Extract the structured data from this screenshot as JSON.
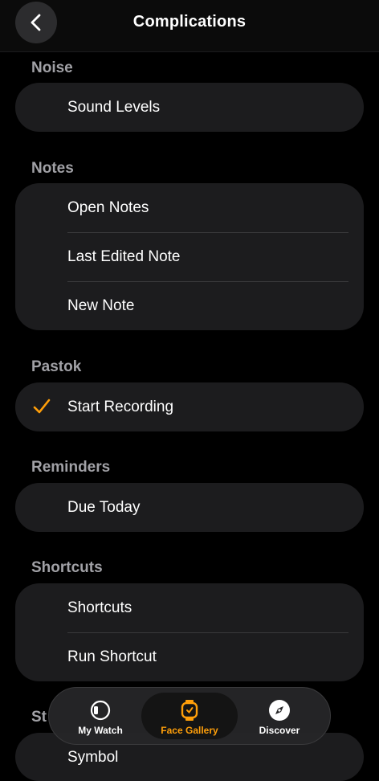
{
  "header": {
    "title": "Complications"
  },
  "sections": [
    {
      "label": "Noise",
      "items": [
        "Sound Levels"
      ]
    },
    {
      "label": "Notes",
      "items": [
        "Open Notes",
        "Last Edited Note",
        "New Note"
      ]
    },
    {
      "label": "Pastok",
      "items": [
        "Start Recording"
      ]
    },
    {
      "label": "Reminders",
      "items": [
        "Due Today"
      ]
    },
    {
      "label": "Shortcuts",
      "items": [
        "Shortcuts",
        "Run Shortcut"
      ]
    },
    {
      "label": "St",
      "items": [
        "Symbol"
      ]
    }
  ],
  "tabs": [
    "My Watch",
    "Face Gallery",
    "Discover"
  ],
  "colors": {
    "accent": "#ff9f0a",
    "card": "#1c1c1e",
    "label": "#a1a1a6"
  }
}
